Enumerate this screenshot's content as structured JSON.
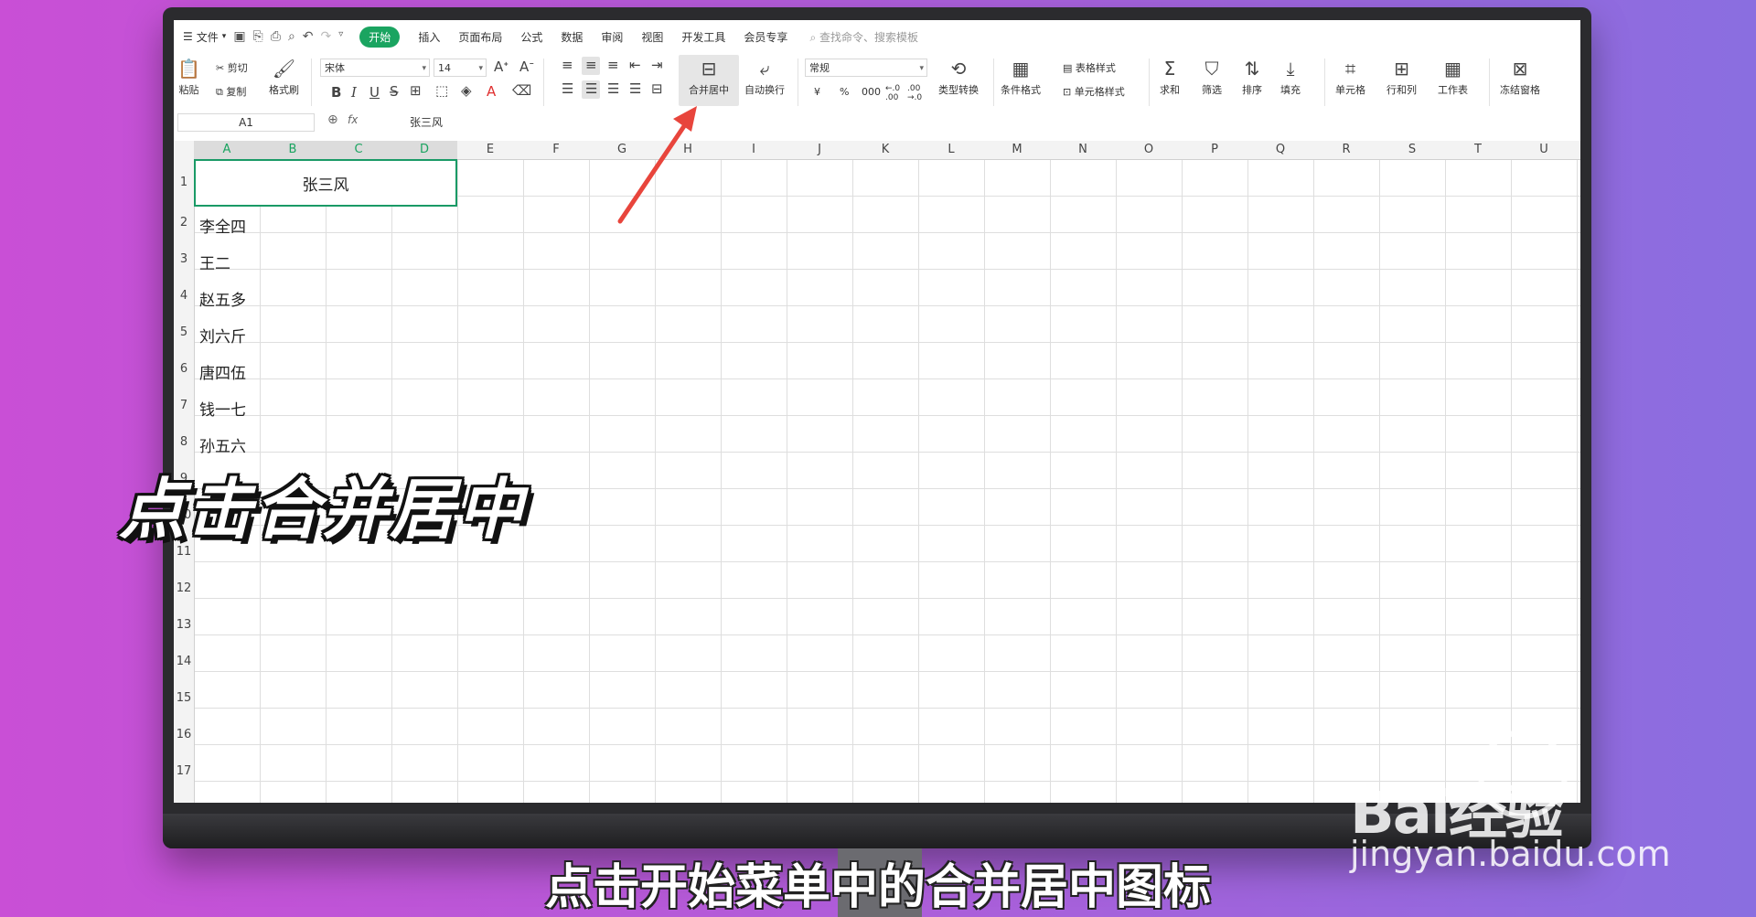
{
  "menu": {
    "file": "文件",
    "tabs": [
      "开始",
      "插入",
      "页面布局",
      "公式",
      "数据",
      "审阅",
      "视图",
      "开发工具",
      "会员专享"
    ],
    "active_tab": "开始",
    "search_placeholder": "查找命令、搜索模板"
  },
  "ribbon": {
    "paste": "粘贴",
    "cut": "剪切",
    "copy": "复制",
    "format_painter": "格式刷",
    "font_name": "宋体",
    "font_size": "14",
    "merge_center": "合并居中",
    "wrap_text": "自动换行",
    "number_format": "常规",
    "type_convert": "类型转换",
    "cond_format": "条件格式",
    "table_style": "表格样式",
    "cell_style": "单元格样式",
    "sum": "求和",
    "filter": "筛选",
    "sort": "排序",
    "fill": "填充",
    "cells": "单元格",
    "row_col": "行和列",
    "worksheet": "工作表",
    "freeze": "冻结窗格",
    "currency": "¥",
    "percent": "%",
    "thousands": "000",
    "bold": "B",
    "italic": "I",
    "underline": "U",
    "font_color": "A"
  },
  "formula_bar": {
    "cell_ref": "A1",
    "fx": "fx",
    "value": "张三风"
  },
  "columns": [
    "A",
    "B",
    "C",
    "D",
    "E",
    "F",
    "G",
    "H",
    "I",
    "J",
    "K",
    "L",
    "M",
    "N",
    "O",
    "P",
    "Q",
    "R",
    "S",
    "T",
    "U"
  ],
  "rows": [
    "1",
    "2",
    "3",
    "4",
    "5",
    "6",
    "7",
    "8",
    "9",
    "10",
    "11",
    "12",
    "13",
    "14",
    "15",
    "16",
    "17"
  ],
  "cells": {
    "A1": "张三风",
    "A2": "李全四",
    "A3": "王二",
    "A4": "赵五多",
    "A5": "刘六斤",
    "A6": "唐四伍",
    "A7": "钱一七",
    "A8": "孙五六"
  },
  "overlay": {
    "caption": "点击合并居中",
    "subtitle": "点击开始菜单中的合并居中图标",
    "watermark_brand": "Bai经验",
    "watermark_url": "jingyan.baidu.com"
  },
  "colors": {
    "accent": "#1aa460",
    "arrow": "#e8453c"
  }
}
